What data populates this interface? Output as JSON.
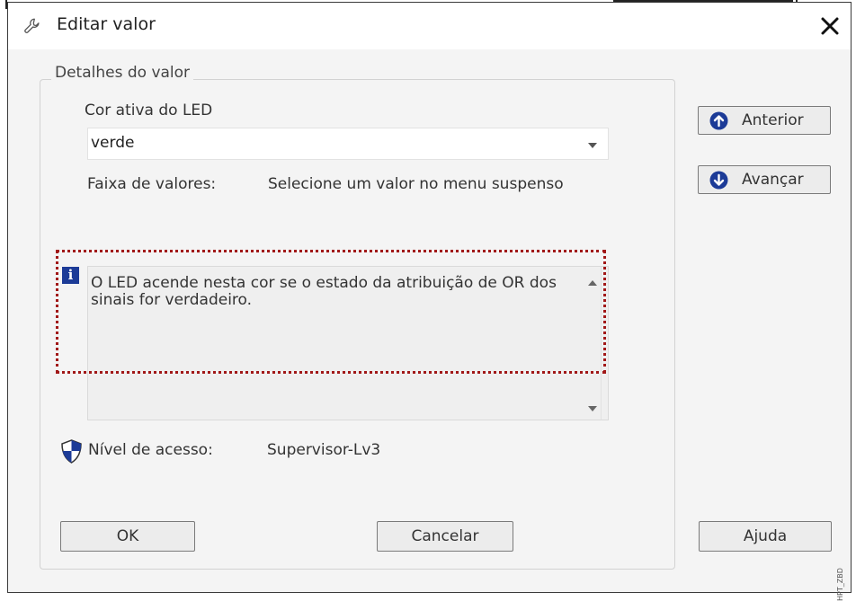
{
  "dialog": {
    "title": "Editar valor",
    "icon": "wrench-icon",
    "close_icon": "close-icon"
  },
  "group": {
    "label": "Detalhes do valor"
  },
  "field": {
    "label": "Cor ativa do LED",
    "selected_value": "verde"
  },
  "range": {
    "label": "Faixa de valores:",
    "value": "Selecione um valor no menu suspenso"
  },
  "info": {
    "icon": "info-icon",
    "text": "O LED acende nesta cor se o estado da atribuição de OR dos sinais for verdadeiro.",
    "highlight_color": "#a11818"
  },
  "access": {
    "icon": "shield-icon",
    "label": "Nível de acesso:",
    "value": "Supervisor-Lv3"
  },
  "nav": {
    "previous_label": "Anterior",
    "previous_icon": "arrow-up-circle-icon",
    "next_label": "Avançar",
    "next_icon": "arrow-down-circle-icon"
  },
  "buttons": {
    "ok": "OK",
    "cancel": "Cancelar",
    "help": "Ajuda"
  },
  "watermark": "HPT_ZBD",
  "colors": {
    "icon_blue": "#1c3b97",
    "content_bg": "#f4f4f4"
  }
}
